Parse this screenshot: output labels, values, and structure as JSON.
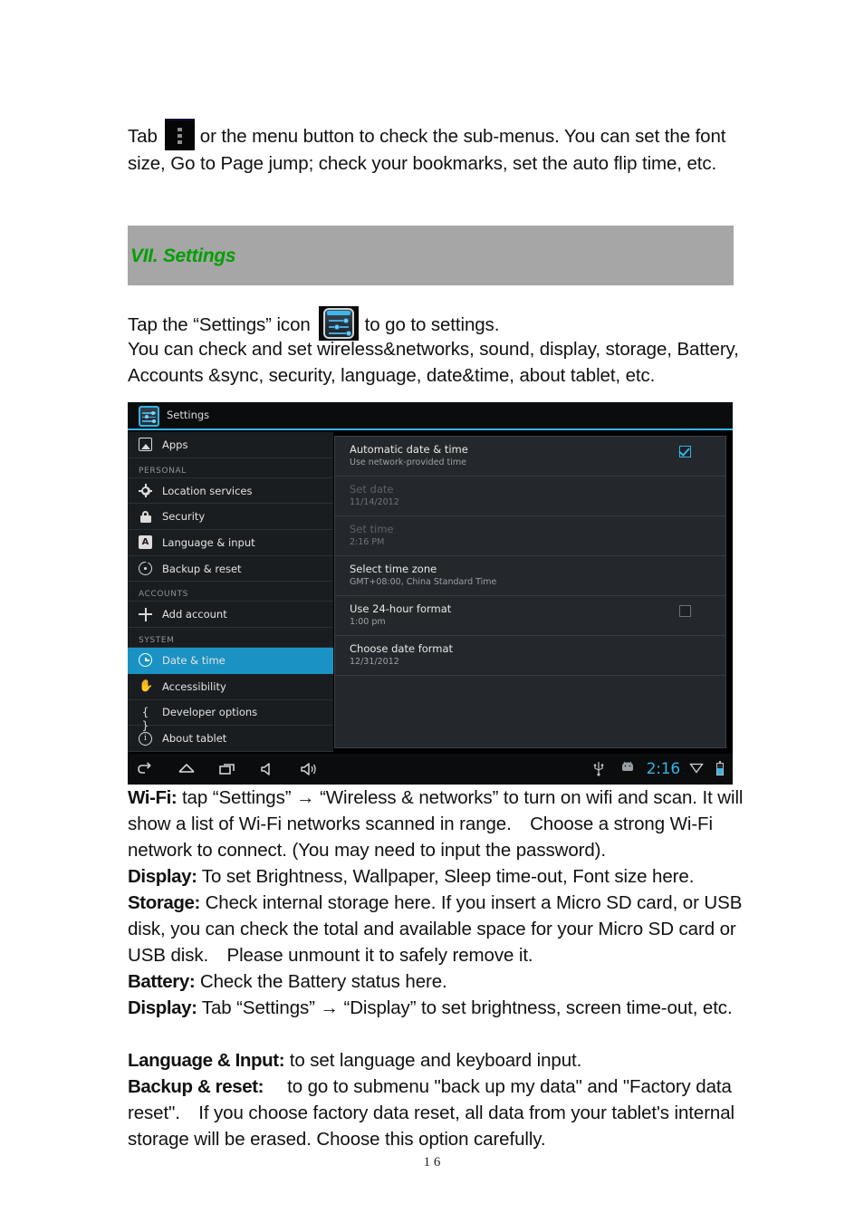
{
  "document": {
    "intro_paragraph_lead": "Tab",
    "menu_icon_name": "overflow-menu-icon",
    "intro_paragraph_rest": "or the menu button to check the sub-menus. You can set the font size, Go to Page jump; check your bookmarks, set the auto flip time, etc.",
    "heading": "VII. Settings",
    "heading_color": "#00a000",
    "heading_band_color": "#a6a6a6",
    "settings_icon_para_lead": "Tap the “Settings” icon",
    "settings_icon_name": "settings-slider-icon",
    "settings_icon_para_rest": "to go to settings.",
    "intro_list_paragraph": "You can check and set wireless&networks, sound, display, storage, Battery, Accounts &sync, security, language, date&time, about tablet, etc.",
    "page_number": "1 6"
  },
  "sections": [
    {
      "id": "wifi",
      "label": "Wi-Fi:",
      "text": "tap “Settings” → “Wireless & networks” to turn on wifi and scan. It will show a list of Wi-Fi networks scanned in range. Choose a strong Wi-Fi network to connect. (You may need to input the password)."
    },
    {
      "id": "display1",
      "label": "Display:",
      "text": "To set Brightness, Wallpaper, Sleep time-out, Font size here."
    },
    {
      "id": "storage",
      "label": "Storage:",
      "text": "Check internal storage here. If you insert a Micro SD card, or USB disk, you can check the total and available space for your Micro SD card or USB disk. Please unmount it to safely remove it."
    },
    {
      "id": "battery",
      "label": "Battery:",
      "text": "Check the Battery status here."
    },
    {
      "id": "display2",
      "label": "Display:",
      "text": "Tab “Settings” → “Display” to set brightness, screen time-out, etc."
    },
    {
      "id": "language",
      "label": "Language & Input:",
      "text": "to set language and keyboard input."
    },
    {
      "id": "backup",
      "label": "Backup & reset:",
      "text": " to go to submenu \"back up my data\" and \"Factory data reset\". If you choose factory data reset, all data from your tablet's internal storage will be erased. Choose this option carefully."
    }
  ],
  "screenshot": {
    "titlebar": {
      "app_title": "Settings",
      "icon": "settings-slider-icon",
      "accent_color": "#33b5e5"
    },
    "sidebar": {
      "selected_color": "#1a93c4",
      "rows": [
        {
          "type": "item",
          "icon": "apps-icon",
          "label": "Apps",
          "selected": false
        },
        {
          "type": "header",
          "label": "PERSONAL"
        },
        {
          "type": "item",
          "icon": "location-crosshair-icon",
          "label": "Location services",
          "selected": false
        },
        {
          "type": "item",
          "icon": "lock-icon",
          "label": "Security",
          "selected": false
        },
        {
          "type": "item",
          "icon": "language-a-icon",
          "label": "Language & input",
          "selected": false
        },
        {
          "type": "item",
          "icon": "backup-reset-icon",
          "label": "Backup & reset",
          "selected": false
        },
        {
          "type": "header",
          "label": "ACCOUNTS"
        },
        {
          "type": "item",
          "icon": "plus-icon",
          "label": "Add account",
          "selected": false
        },
        {
          "type": "header",
          "label": "SYSTEM"
        },
        {
          "type": "item",
          "icon": "clock-icon",
          "label": "Date & time",
          "selected": true
        },
        {
          "type": "item",
          "icon": "accessibility-hand-icon",
          "label": "Accessibility",
          "selected": false
        },
        {
          "type": "item",
          "icon": "developer-braces-icon",
          "label": "Developer options",
          "selected": false
        },
        {
          "type": "item",
          "icon": "info-circle-icon",
          "label": "About tablet",
          "selected": false
        }
      ]
    },
    "content": {
      "rows": [
        {
          "title": "Automatic date & time",
          "subtitle": "Use network-provided time",
          "disabled": false,
          "checkbox": "checked"
        },
        {
          "title": "Set date",
          "subtitle": "11/14/2012",
          "disabled": true,
          "checkbox": "none"
        },
        {
          "title": "Set time",
          "subtitle": "2:16 PM",
          "disabled": true,
          "checkbox": "none"
        },
        {
          "title": "Select time zone",
          "subtitle": "GMT+08:00, China Standard Time",
          "disabled": false,
          "checkbox": "none"
        },
        {
          "title": "Use 24-hour format",
          "subtitle": "1:00 pm",
          "disabled": false,
          "checkbox": "unchecked"
        },
        {
          "title": "Choose date format",
          "subtitle": "12/31/2012",
          "disabled": false,
          "checkbox": "none"
        }
      ]
    },
    "navbar": {
      "left_icons": [
        "back-icon",
        "home-icon",
        "recent-apps-icon",
        "volume-down-icon",
        "volume-up-icon"
      ],
      "right_icons": [
        "usb-icon",
        "android-robot-icon",
        "wifi-icon",
        "battery-icon"
      ],
      "clock": "2:16",
      "clock_color": "#33b5e5"
    }
  }
}
